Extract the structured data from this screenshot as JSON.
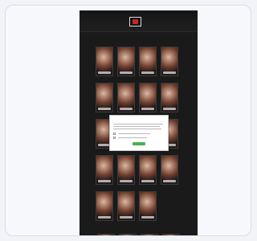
{
  "colors": {
    "page_bg": "#f1f3f7",
    "site_bg": "#1a1a1a",
    "modal_accept": "#4caf50",
    "logo_accent": "#c62828"
  },
  "icons": {
    "logo": "site-logo-icon"
  },
  "nav": {
    "items": [
      "",
      "",
      "",
      ""
    ]
  },
  "sections": {
    "top_title": "",
    "bottom_title": ""
  },
  "modal": {
    "title": "",
    "accept_label": ""
  }
}
